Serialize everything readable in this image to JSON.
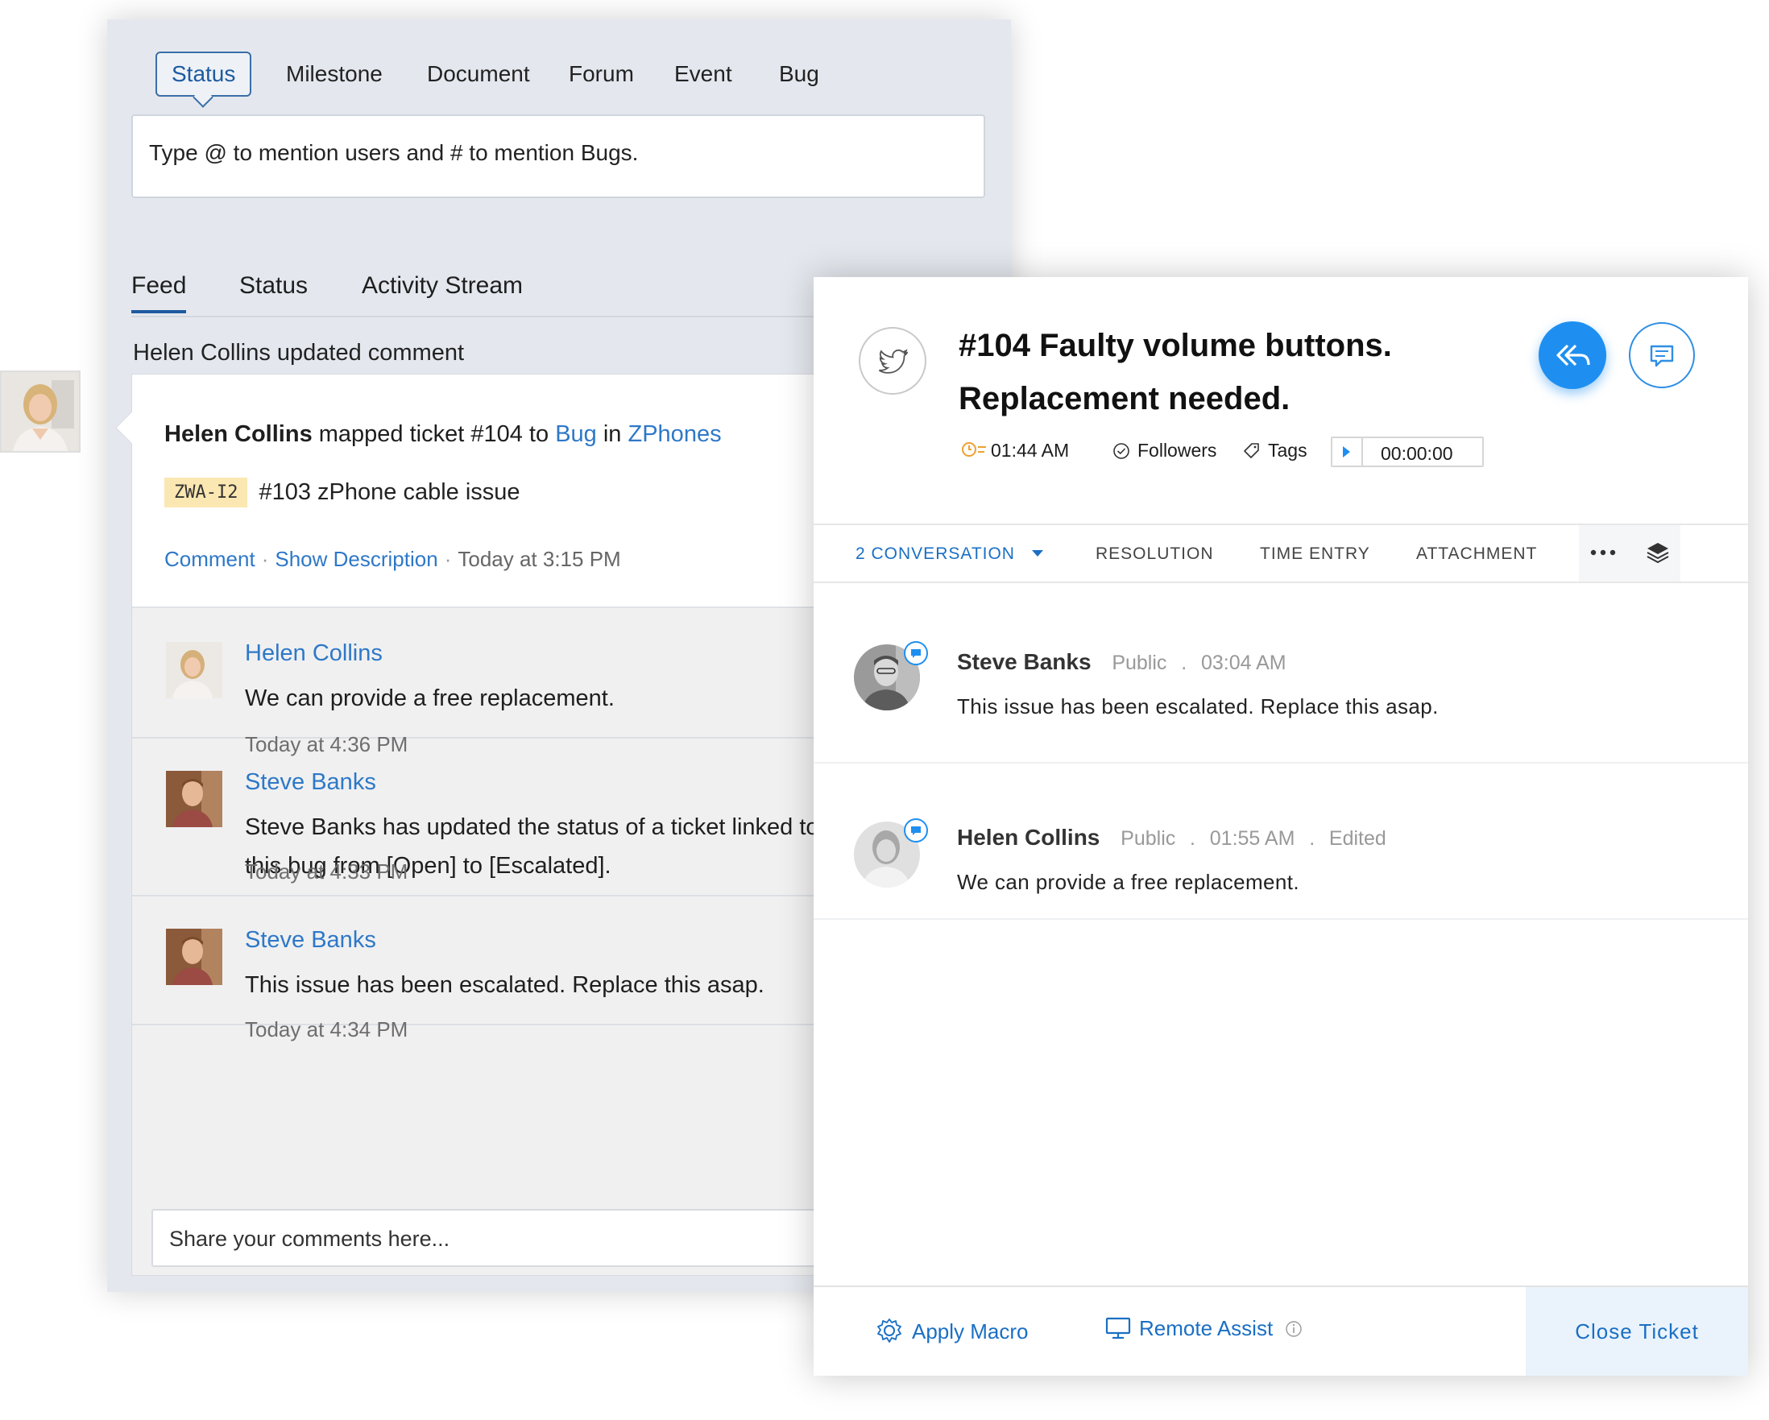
{
  "top_tabs": [
    "Status",
    "Milestone",
    "Document",
    "Forum",
    "Event",
    "Bug"
  ],
  "mention_placeholder": "Type @ to mention users and # to mention Bugs.",
  "feed_tabs": [
    "Feed",
    "Status",
    "Activity Stream"
  ],
  "update_line": "Helen Collins updated comment",
  "mapped": {
    "user": "Helen Collins",
    "text_1": "mapped ticket #104 to",
    "bug_link": "Bug",
    "text_2": "in",
    "project_link": "ZPhones",
    "bug_code": "ZWA-I2",
    "bug_title": "#103 zPhone cable issue",
    "comment_link": "Comment",
    "description_link": "Show Description",
    "time": "Today at 3:15 PM"
  },
  "comments": [
    {
      "name": "Helen Collins",
      "text": "We can provide a free replacement.",
      "time": "Today at 4:36 PM"
    },
    {
      "name": "Steve Banks",
      "text": "Steve Banks has updated the status of a ticket linked to this bug from [Open] to [Escalated].",
      "time": "Today at 4:33 PM"
    },
    {
      "name": "Steve Banks",
      "text": "This issue has been escalated. Replace this asap.",
      "time": "Today at 4:34 PM"
    }
  ],
  "share_placeholder": "Share your comments here...",
  "ticket": {
    "title": "#104  Faulty volume buttons. Replacement needed.",
    "time": "01:44 AM",
    "followers": "Followers",
    "tags": "Tags",
    "timer": "00:00:00",
    "tabs": [
      "2  CONVERSATION",
      "RESOLUTION",
      "TIME ENTRY",
      "ATTACHMENT"
    ],
    "messages": [
      {
        "name": "Steve Banks",
        "visibility": "Public",
        "time": "03:04 AM",
        "edited": "",
        "text": "This issue has been escalated. Replace this asap."
      },
      {
        "name": "Helen Collins",
        "visibility": "Public",
        "time": "01:55 AM",
        "edited": "Edited",
        "text": "We can provide a free replacement."
      }
    ],
    "footer": {
      "apply_macro": "Apply Macro",
      "remote_assist": "Remote Assist",
      "close_ticket": "Close Ticket"
    }
  },
  "colors": {
    "link": "#2e78c7",
    "accent": "#1e8ff0",
    "bug_code_bg": "#fbe7b1"
  },
  "icons": [
    "twitter-icon",
    "reply-all-icon",
    "comment-icon",
    "clock-icon",
    "check-circle-icon",
    "tag-icon",
    "play-icon",
    "more-icon",
    "layers-icon",
    "gear-icon",
    "monitor-icon",
    "info-icon",
    "caret-down-icon"
  ]
}
